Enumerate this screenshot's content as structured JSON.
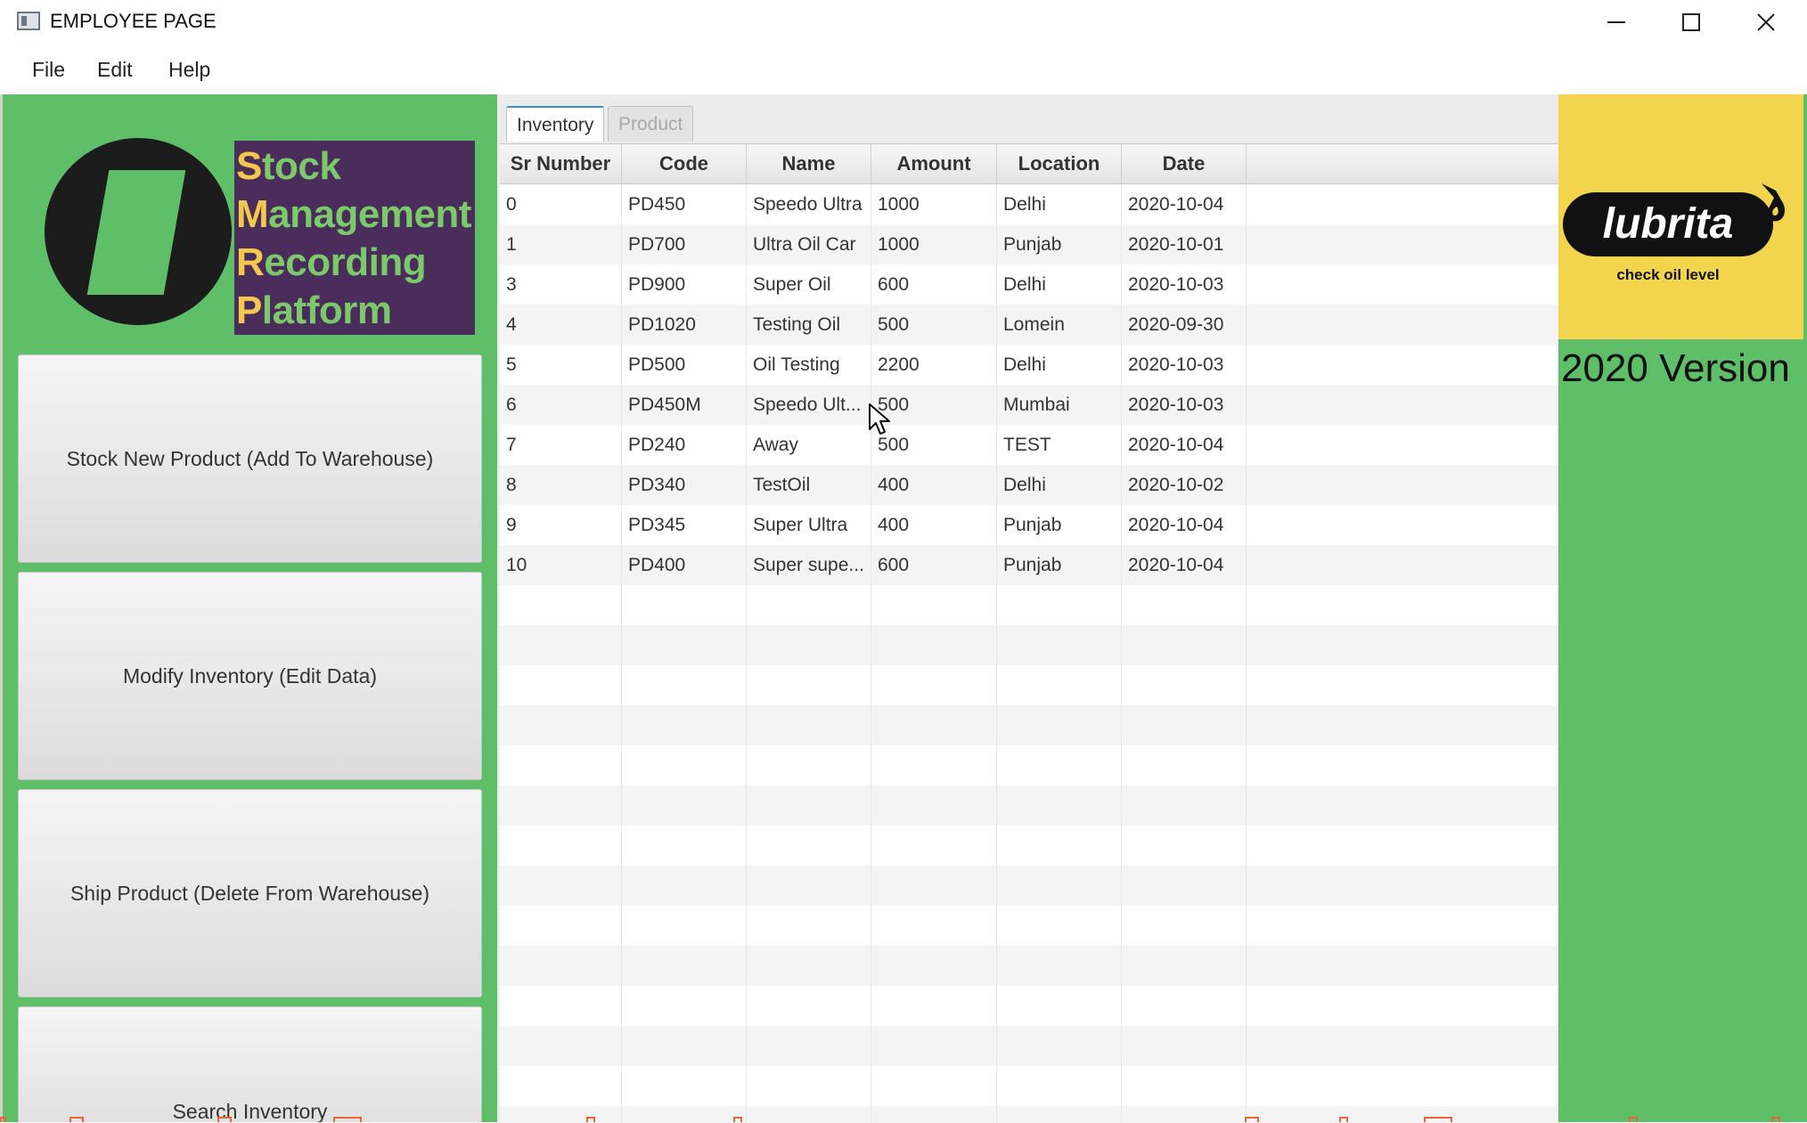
{
  "window": {
    "title": "EMPLOYEE PAGE",
    "minimize_icon": "minimize-icon",
    "maximize_icon": "maximize-icon",
    "close_icon": "close-icon"
  },
  "menu": {
    "file": "File",
    "edit": "Edit",
    "help": "Help"
  },
  "logo": {
    "line1_cap": "S",
    "line1_rest": "tock",
    "line2_cap": "M",
    "line2_rest": "anagement",
    "line3_cap": "R",
    "line3_rest": "ecording",
    "line4_cap": "P",
    "line4_rest": "latform"
  },
  "actions": {
    "stock": "Stock New Product (Add To Warehouse)",
    "modify": "Modify Inventory (Edit Data)",
    "ship": "Ship Product (Delete From Warehouse)",
    "search": "Search Inventory"
  },
  "tabs": {
    "inventory": "Inventory",
    "product": "Product",
    "active": "Inventory"
  },
  "table": {
    "columns": [
      "Sr Number",
      "Code",
      "Name",
      "Amount",
      "Location",
      "Date"
    ],
    "rows": [
      [
        "0",
        "PD450",
        "Speedo Ultra",
        "1000",
        "Delhi",
        "2020-10-04"
      ],
      [
        "1",
        "PD700",
        "Ultra Oil Car",
        "1000",
        "Punjab",
        "2020-10-01"
      ],
      [
        "3",
        "PD900",
        "Super Oil",
        "600",
        "Delhi",
        "2020-10-03"
      ],
      [
        "4",
        "PD1020",
        "Testing Oil",
        "500",
        "Lomein",
        "2020-09-30"
      ],
      [
        "5",
        "PD500",
        "Oil Testing",
        "2200",
        "Delhi",
        "2020-10-03"
      ],
      [
        "6",
        "PD450M",
        "Speedo Ult...",
        "500",
        "Mumbai",
        "2020-10-03"
      ],
      [
        "7",
        "PD240",
        "Away",
        "500",
        "TEST",
        "2020-10-04"
      ],
      [
        "8",
        "PD340",
        "TestOil",
        "400",
        "Delhi",
        "2020-10-02"
      ],
      [
        "9",
        "PD345",
        "Super Ultra",
        "400",
        "Punjab",
        "2020-10-04"
      ],
      [
        "10",
        "PD400",
        "Super supe...",
        "600",
        "Punjab",
        "2020-10-04"
      ]
    ]
  },
  "brand": {
    "name": "lubrita",
    "tagline": "check oil level",
    "version": "2020 Version"
  },
  "colors": {
    "panel_green": "#5fbf69",
    "logo_purple": "#4a2d5a",
    "logo_cap": "#f2c94c",
    "brand_yellow": "#f3d44d",
    "tab_accent": "#3a8fd6"
  }
}
